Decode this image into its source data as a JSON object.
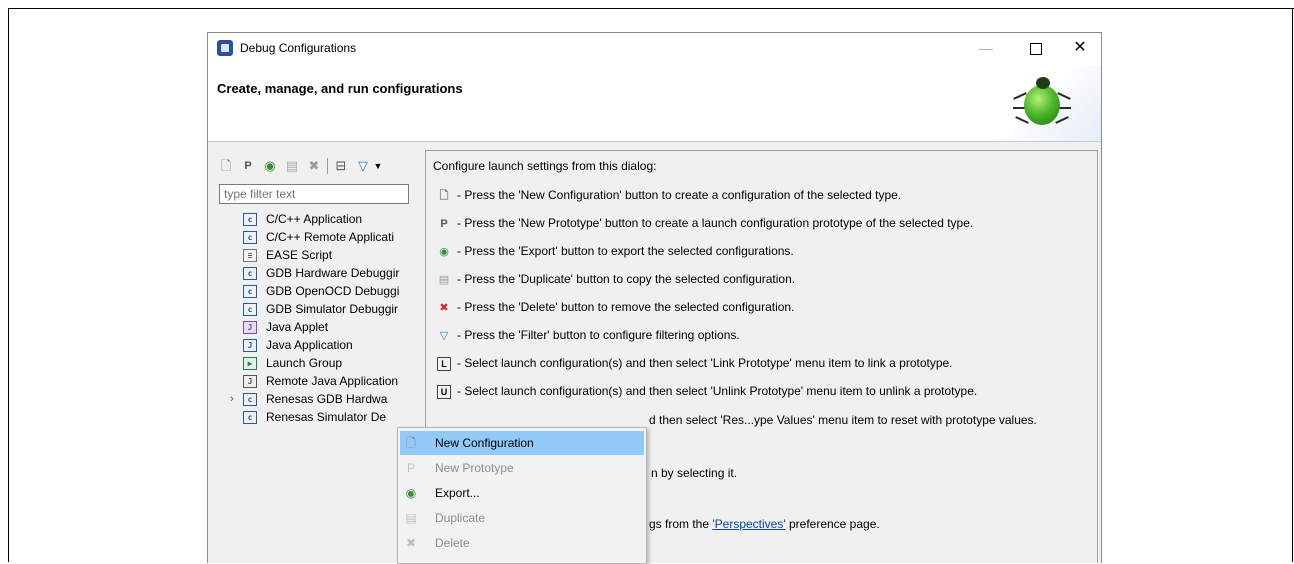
{
  "window": {
    "title": "Debug Configurations",
    "minimize_label": "—",
    "close_label": "✕"
  },
  "header": {
    "title": "Create, manage, and run configurations"
  },
  "toolbar": {
    "icons": [
      "new-configuration-icon",
      "new-prototype-icon",
      "export-icon",
      "duplicate-icon",
      "delete-icon",
      "collapse-all-icon",
      "filter-icon",
      "view-menu-icon"
    ]
  },
  "filter": {
    "placeholder": "type filter text"
  },
  "tree": {
    "items": [
      {
        "label": "C/C++ Application",
        "icon": "c-config-icon"
      },
      {
        "label": "C/C++ Remote Applicati",
        "icon": "c-config-icon"
      },
      {
        "label": "EASE Script",
        "icon": "script-icon"
      },
      {
        "label": "GDB Hardware Debuggir",
        "icon": "c-config-icon"
      },
      {
        "label": "GDB OpenOCD Debuggi",
        "icon": "c-config-icon"
      },
      {
        "label": "GDB Simulator Debuggir",
        "icon": "c-config-icon"
      },
      {
        "label": "Java Applet",
        "icon": "java-applet-icon"
      },
      {
        "label": "Java Application",
        "icon": "java-app-icon"
      },
      {
        "label": "Launch Group",
        "icon": "launch-group-icon"
      },
      {
        "label": "Remote Java Application",
        "icon": "remote-java-icon"
      },
      {
        "label": "Renesas GDB Hardwa",
        "icon": "c-config-icon",
        "expandable": true,
        "expander": "›"
      },
      {
        "label": "Renesas Simulator De",
        "icon": "c-config-icon"
      }
    ]
  },
  "right_panel": {
    "intro": "Configure launch settings from this dialog:",
    "rows": [
      {
        "icon": "new-configuration-icon",
        "text": "- Press the 'New Configuration' button to create a configuration of the selected type."
      },
      {
        "icon": "new-prototype-icon",
        "text": "- Press the 'New Prototype' button to create a launch configuration prototype of the selected type."
      },
      {
        "icon": "export-icon",
        "text": "- Press the 'Export' button to export the selected configurations."
      },
      {
        "icon": "duplicate-icon",
        "text": "- Press the 'Duplicate' button to copy the selected configuration."
      },
      {
        "icon": "delete-icon",
        "text": "- Press the 'Delete' button to remove the selected configuration."
      },
      {
        "icon": "filter-icon",
        "text": "- Press the 'Filter' button to configure filtering options."
      },
      {
        "icon": "link-prototype-icon",
        "text": "- Select launch configuration(s) and then select 'Link Prototype' menu item to link a prototype."
      },
      {
        "icon": "unlink-prototype-icon",
        "text": "- Select launch configuration(s) and then select 'Unlink Prototype' menu item to unlink a prototype."
      }
    ],
    "partial_reset": "d then select 'Res...ype Values' menu item to reset with prototype values.",
    "partial_select": "n by selecting it.",
    "partial_perspectives_before": "gs from the ",
    "perspectives_link": "'Perspectives'",
    "partial_perspectives_after": " preference page."
  },
  "context_menu": {
    "items": [
      {
        "label": "New Configuration",
        "icon": "new-configuration-icon",
        "enabled": true,
        "highlighted": true
      },
      {
        "label": "New Prototype",
        "icon": "new-prototype-icon",
        "enabled": false
      },
      {
        "label": "Export...",
        "icon": "export-icon",
        "enabled": true
      },
      {
        "label": "Duplicate",
        "icon": "duplicate-icon",
        "enabled": false
      },
      {
        "label": "Delete",
        "icon": "delete-icon",
        "enabled": false
      }
    ]
  },
  "colors": {
    "selection": "#91c9f7",
    "delete_red": "#d9262b",
    "link": "#0645ad"
  }
}
